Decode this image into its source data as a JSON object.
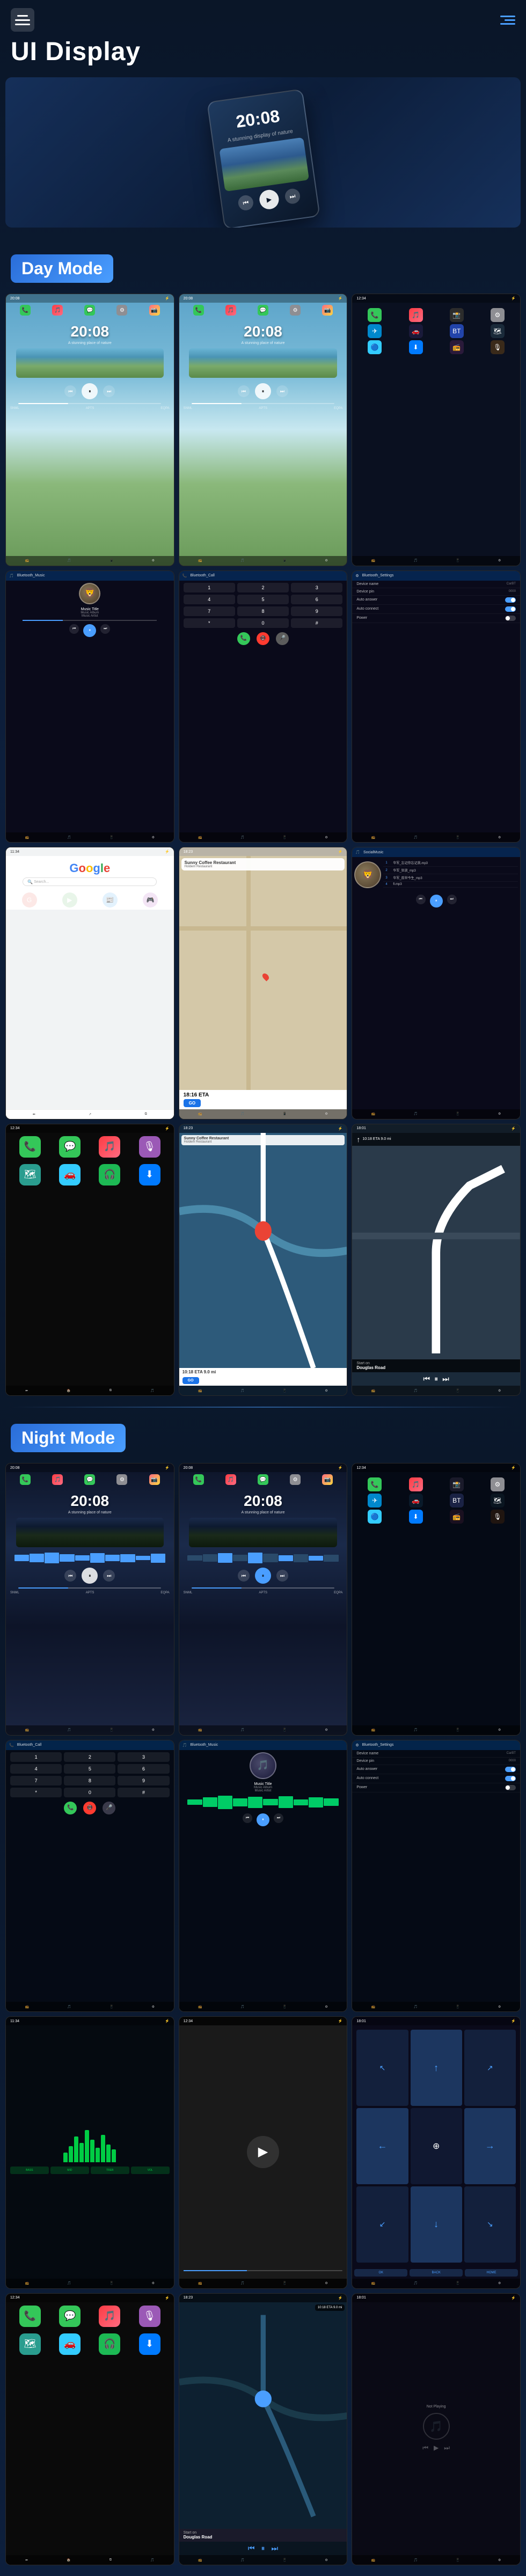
{
  "header": {
    "title": "UI Display",
    "menu_label": "menu"
  },
  "hero": {
    "time": "20:08",
    "subtitle": "A stunning display of nature"
  },
  "modes": {
    "day": {
      "label": "Day Mode",
      "screens": [
        {
          "type": "home_day",
          "time": "20:08"
        },
        {
          "type": "home_day2",
          "time": "20:08"
        },
        {
          "type": "apps_day"
        }
      ]
    },
    "night": {
      "label": "Night Mode",
      "screens": [
        {
          "type": "home_night",
          "time": "20:08"
        },
        {
          "type": "home_night2",
          "time": "20:08"
        },
        {
          "type": "apps_night"
        }
      ]
    }
  },
  "music": {
    "title": "Music Title",
    "album": "Music Album",
    "artist": "Music Artist"
  },
  "settings": {
    "device_name_label": "Device name",
    "device_name_value": "CarBT",
    "device_pin_label": "Device pin",
    "device_pin_value": "0000",
    "auto_answer_label": "Auto answer",
    "auto_connect_label": "Auto connect",
    "power_label": "Power"
  },
  "map": {
    "restaurant": "Sunny Coffee Restaurant",
    "address": "Holdem\nRestaurant",
    "eta": "18:16 ETA",
    "distance": "9.0 mi",
    "time_label": "10:18 ETA  9.0 mi",
    "instruction": "Start on\nDouglas Road",
    "not_playing": "Not Playing",
    "go_label": "GO"
  },
  "dial_buttons": [
    "1",
    "2",
    "3",
    "4",
    "5",
    "6",
    "7",
    "8",
    "9",
    "*",
    "0",
    "#"
  ],
  "local_tracks": [
    "华军_忘记你忘记我.mp3",
    "华军_狂放_mp3",
    "华军_前世今生_mp3",
    "fl.mp3"
  ],
  "bottom_labels": [
    "SNML",
    "APTS",
    "EQPA"
  ]
}
